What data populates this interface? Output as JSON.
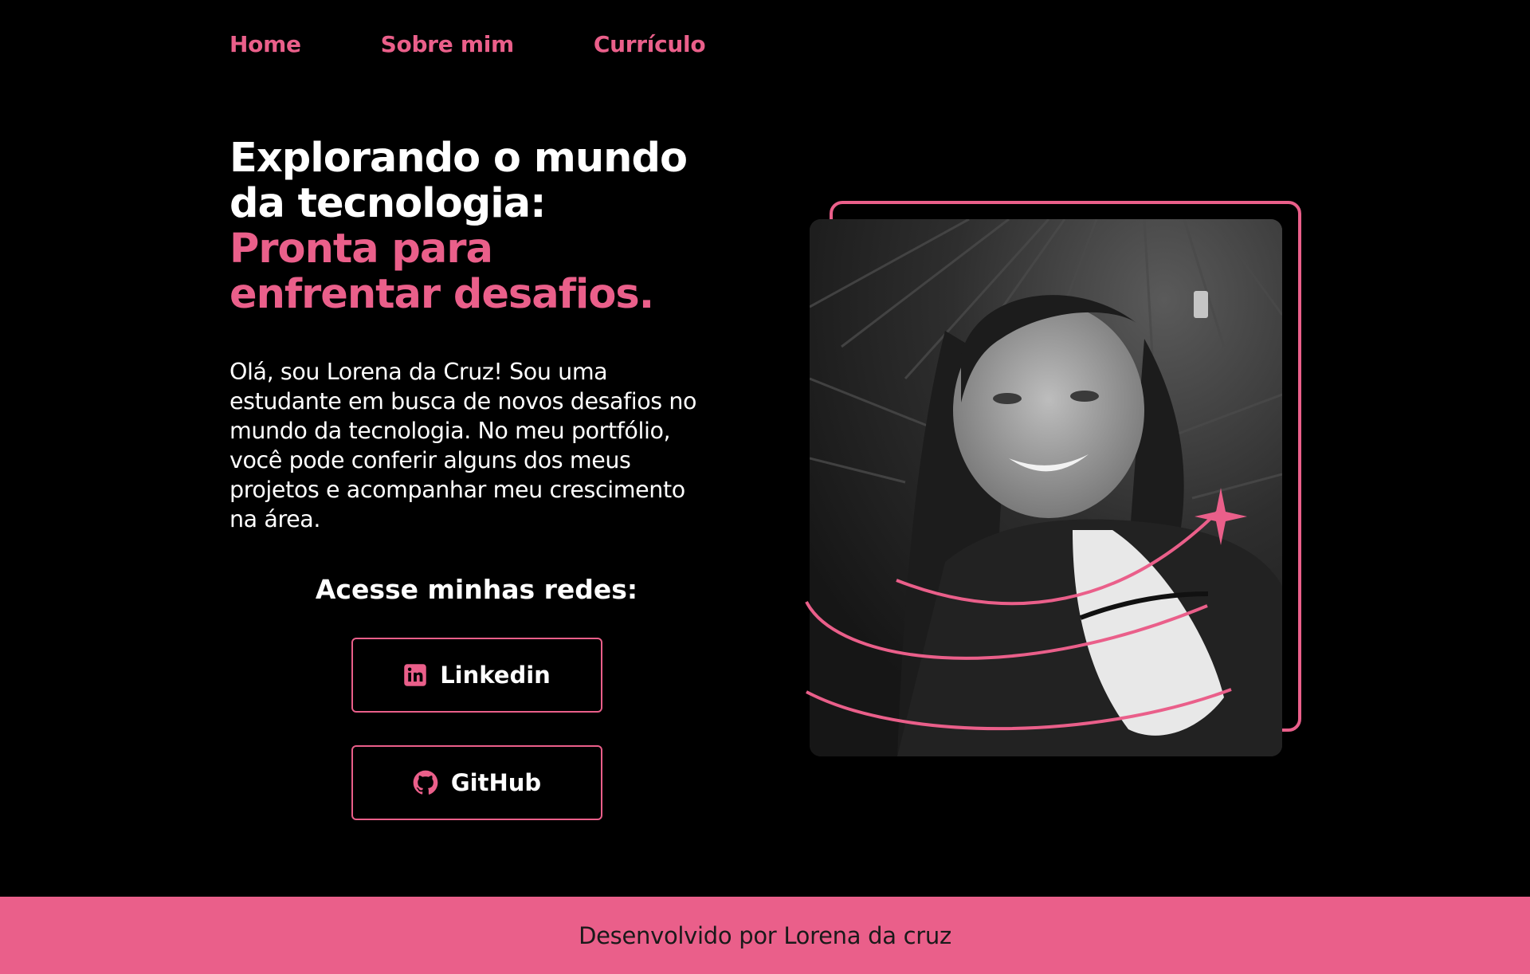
{
  "nav": {
    "items": [
      {
        "label": "Home"
      },
      {
        "label": "Sobre mim"
      },
      {
        "label": "Currículo"
      }
    ]
  },
  "hero": {
    "title_line1": "Explorando o mundo",
    "title_line2": "da tecnologia:",
    "title_line3": "Pronta para",
    "title_line4": "enfrentar desafios.",
    "intro": "Olá, sou Lorena da Cruz! Sou uma estudante em busca de novos desafios no mundo da tecnologia. No meu portfólio, você pode conferir alguns dos meus projetos e acompanhar meu crescimento na área."
  },
  "social": {
    "heading": "Acesse minhas redes:",
    "buttons": [
      {
        "label": "Linkedin",
        "icon": "linkedin-icon"
      },
      {
        "label": "GitHub",
        "icon": "github-icon"
      }
    ]
  },
  "footer": {
    "text": "Desenvolvido por Lorena da cruz"
  },
  "colors": {
    "background": "#000000",
    "accent": "#ea5f8a",
    "text": "#ffffff"
  }
}
